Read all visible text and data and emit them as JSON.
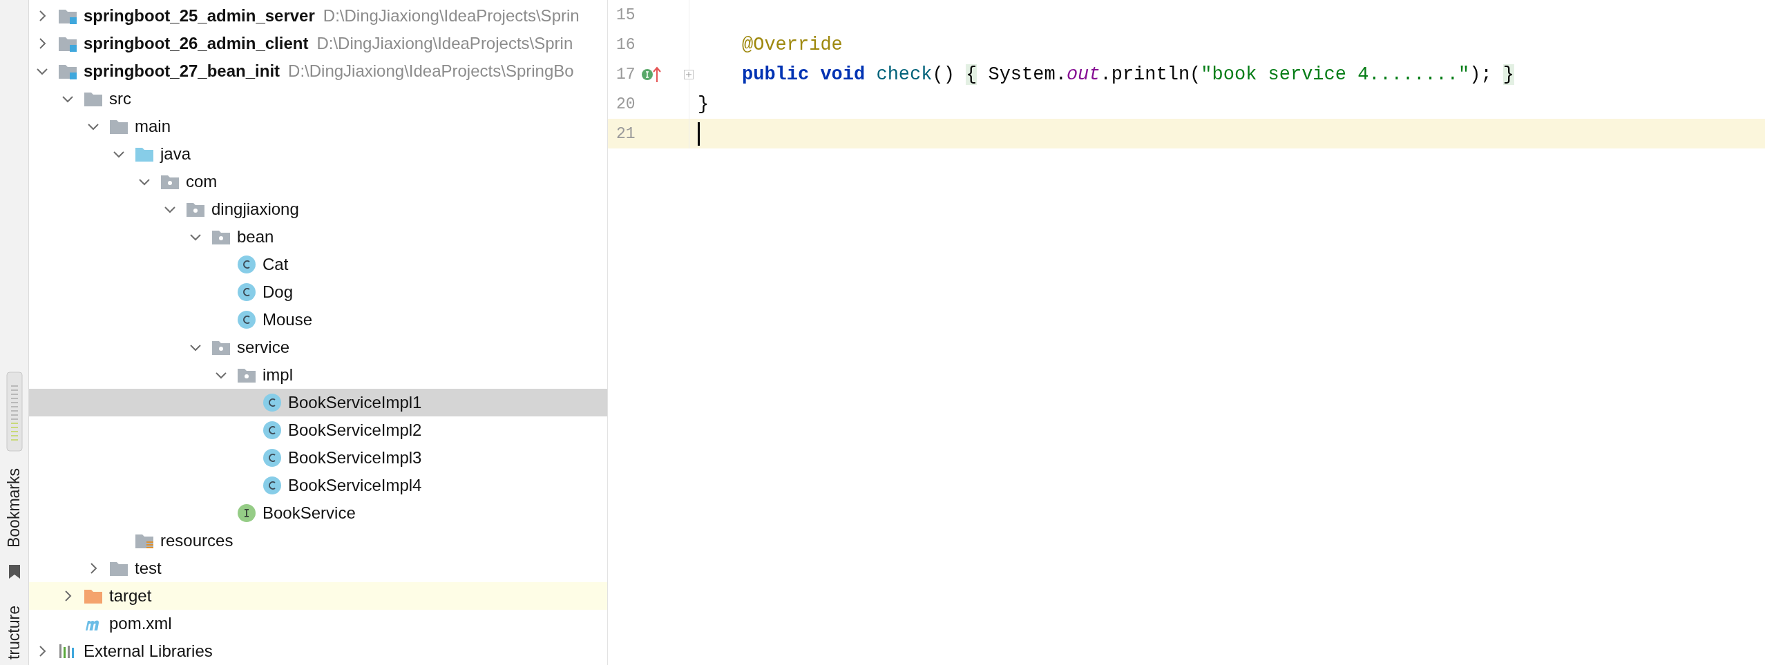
{
  "tool_strip": {
    "labels": [
      "Bookmarks",
      "tructure"
    ]
  },
  "project_tree": [
    {
      "name": "springboot_25_admin_server",
      "path": "D:\\DingJiaxiong\\IdeaProjects\\Sprin",
      "kind": "module",
      "expanded": false,
      "selected": false,
      "highlighted": false
    },
    {
      "name": "springboot_26_admin_client",
      "path": "D:\\DingJiaxiong\\IdeaProjects\\Sprin",
      "kind": "module",
      "expanded": false,
      "selected": false,
      "highlighted": false
    },
    {
      "name": "springboot_27_bean_init",
      "path": "D:\\DingJiaxiong\\IdeaProjects\\SpringBo",
      "kind": "module",
      "expanded": true,
      "selected": false,
      "highlighted": false,
      "children": [
        {
          "name": "src",
          "kind": "folder",
          "expanded": true,
          "selected": false,
          "highlighted": false,
          "children": [
            {
              "name": "main",
              "kind": "folder",
              "expanded": true,
              "selected": false,
              "highlighted": false,
              "children": [
                {
                  "name": "java",
                  "kind": "source-folder",
                  "expanded": true,
                  "selected": false,
                  "highlighted": false,
                  "children": [
                    {
                      "name": "com",
                      "kind": "package",
                      "expanded": true,
                      "selected": false,
                      "highlighted": false,
                      "children": [
                        {
                          "name": "dingjiaxiong",
                          "kind": "package",
                          "expanded": true,
                          "selected": false,
                          "highlighted": false,
                          "children": [
                            {
                              "name": "bean",
                              "kind": "package",
                              "expanded": true,
                              "selected": false,
                              "highlighted": false,
                              "children": [
                                {
                                  "name": "Cat",
                                  "kind": "class",
                                  "selected": false,
                                  "highlighted": false
                                },
                                {
                                  "name": "Dog",
                                  "kind": "class",
                                  "selected": false,
                                  "highlighted": false
                                },
                                {
                                  "name": "Mouse",
                                  "kind": "class",
                                  "selected": false,
                                  "highlighted": false
                                }
                              ]
                            },
                            {
                              "name": "service",
                              "kind": "package",
                              "expanded": true,
                              "selected": false,
                              "highlighted": false,
                              "children": [
                                {
                                  "name": "impl",
                                  "kind": "package",
                                  "expanded": true,
                                  "selected": false,
                                  "highlighted": false,
                                  "children": [
                                    {
                                      "name": "BookServiceImpl1",
                                      "kind": "class",
                                      "selected": true,
                                      "highlighted": false
                                    },
                                    {
                                      "name": "BookServiceImpl2",
                                      "kind": "class",
                                      "selected": false,
                                      "highlighted": false
                                    },
                                    {
                                      "name": "BookServiceImpl3",
                                      "kind": "class",
                                      "selected": false,
                                      "highlighted": false
                                    },
                                    {
                                      "name": "BookServiceImpl4",
                                      "kind": "class",
                                      "selected": false,
                                      "highlighted": false
                                    }
                                  ]
                                },
                                {
                                  "name": "BookService",
                                  "kind": "interface",
                                  "selected": false,
                                  "highlighted": false
                                }
                              ]
                            }
                          ]
                        }
                      ]
                    }
                  ]
                },
                {
                  "name": "resources",
                  "kind": "resources-folder",
                  "selected": false,
                  "highlighted": false
                }
              ]
            },
            {
              "name": "test",
              "kind": "folder",
              "expanded": false,
              "selected": false,
              "highlighted": false
            }
          ]
        },
        {
          "name": "target",
          "kind": "excluded-folder",
          "expanded": false,
          "selected": false,
          "highlighted": true
        },
        {
          "name": "pom.xml",
          "kind": "maven",
          "selected": false,
          "highlighted": false
        }
      ]
    },
    {
      "name": "External Libraries",
      "kind": "libraries",
      "expanded": false,
      "selected": false,
      "highlighted": false
    }
  ],
  "editor": {
    "lines": [
      {
        "number": "15",
        "current": false
      },
      {
        "number": "16",
        "current": false,
        "indented": true,
        "tokens": [
          {
            "text": "@Override",
            "kind": "annotation"
          }
        ]
      },
      {
        "number": "17",
        "current": false,
        "indented": true,
        "implements_marker": true,
        "foldable": true,
        "tokens": [
          {
            "text": "public void ",
            "kind": "keyword"
          },
          {
            "text": "check",
            "kind": "method"
          },
          {
            "text": "() ",
            "kind": "plain"
          },
          {
            "text": "{",
            "kind": "brace"
          },
          {
            "text": " System.",
            "kind": "plain"
          },
          {
            "text": "out",
            "kind": "static-field"
          },
          {
            "text": ".println(",
            "kind": "plain"
          },
          {
            "text": "\"book service 4........\"",
            "kind": "string"
          },
          {
            "text": "); ",
            "kind": "plain"
          },
          {
            "text": "}",
            "kind": "brace"
          }
        ]
      },
      {
        "number": "20",
        "current": false,
        "indented": false,
        "tokens": [
          {
            "text": "}",
            "kind": "plain"
          }
        ]
      },
      {
        "number": "21",
        "current": true
      }
    ]
  }
}
